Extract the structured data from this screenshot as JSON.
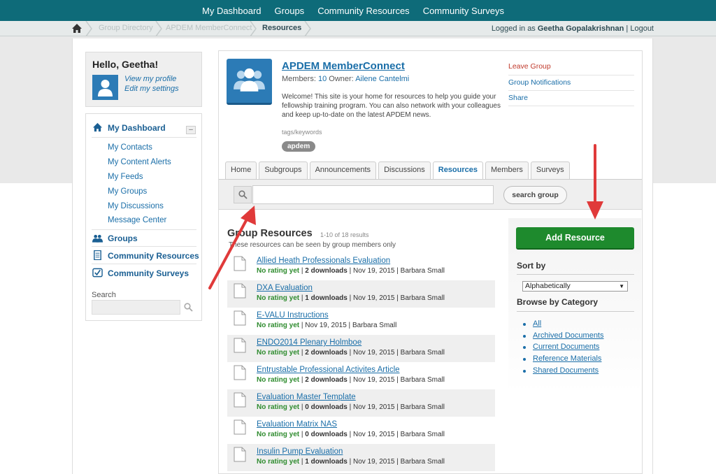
{
  "topnav": [
    "My Dashboard",
    "Groups",
    "Community Resources",
    "Community Surveys"
  ],
  "breadcrumb": {
    "items": [
      "Group Directory",
      "APDEM MemberConnect"
    ],
    "current": "Resources"
  },
  "login": {
    "prefix": "Logged in as",
    "user": "Geetha Gopalakrishnan",
    "sep": "|",
    "logout": "Logout"
  },
  "profile": {
    "greeting": "Hello, Geetha!",
    "view_profile": "View my profile",
    "edit_settings": "Edit my settings"
  },
  "sidebar": {
    "dashboard": "My Dashboard",
    "collapse": "–",
    "items": [
      "My Contacts",
      "My Content Alerts",
      "My Feeds",
      "My Groups",
      "My Discussions",
      "Message Center"
    ],
    "groups": "Groups",
    "community_resources": "Community Resources",
    "community_surveys": "Community Surveys",
    "search_label": "Search"
  },
  "group": {
    "title": "APDEM MemberConnect",
    "members_label": "Members:",
    "members_count": "10",
    "owner_label": "Owner:",
    "owner": "Ailene Cantelmi",
    "welcome": "Welcome! This site is your home for resources to help you guide your fellowship training program. You can also network with your colleagues and keep up-to-date on the latest APDEM news.",
    "tags_label": "tags/keywords",
    "tag": "apdem",
    "links": {
      "leave": "Leave Group",
      "notifications": "Group Notifications",
      "share": "Share"
    }
  },
  "tabs": [
    "Home",
    "Subgroups",
    "Announcements",
    "Discussions",
    "Resources",
    "Members",
    "Surveys"
  ],
  "active_tab": "Resources",
  "search": {
    "button": "search group",
    "value": ""
  },
  "resources": {
    "title": "Group Resources",
    "count": "1-10 of 18 results",
    "subtitle": "These resources can be seen by group members only",
    "rows": [
      {
        "title": "Allied Heath Professionals Evaluation",
        "rating": "No rating yet",
        "downloads": "2 downloads",
        "date": "Nov 19, 2015",
        "author": "Barbara Small"
      },
      {
        "title": "DXA Evaluation",
        "rating": "No rating yet",
        "downloads": "1 downloads",
        "date": "Nov 19, 2015",
        "author": "Barbara Small"
      },
      {
        "title": "E-VALU Instructions",
        "rating": "No rating yet",
        "downloads": "",
        "date": "Nov 19, 2015",
        "author": "Barbara Small"
      },
      {
        "title": "ENDO2014 Plenary Holmboe",
        "rating": "No rating yet",
        "downloads": "2 downloads",
        "date": "Nov 19, 2015",
        "author": "Barbara Small"
      },
      {
        "title": "Entrustable Professional Activites Article",
        "rating": "No rating yet",
        "downloads": "2 downloads",
        "date": "Nov 19, 2015",
        "author": "Barbara Small"
      },
      {
        "title": "Evaluation Master Template",
        "rating": "No rating yet",
        "downloads": "0 downloads",
        "date": "Nov 19, 2015",
        "author": "Barbara Small"
      },
      {
        "title": "Evaluation Matrix NAS",
        "rating": "No rating yet",
        "downloads": "0 downloads",
        "date": "Nov 19, 2015",
        "author": "Barbara Small"
      },
      {
        "title": "Insulin Pump Evaluation",
        "rating": "No rating yet",
        "downloads": "1 downloads",
        "date": "Nov 19, 2015",
        "author": "Barbara Small"
      }
    ]
  },
  "right": {
    "add_button": "Add Resource",
    "sort_label": "Sort by",
    "sort_value": "Alphabetically",
    "browse_label": "Browse by Category",
    "categories": [
      "All",
      "Archived Documents",
      "Current Documents",
      "Reference Materials",
      "Shared Documents"
    ]
  },
  "colors": {
    "nav": "#0e6b79",
    "link": "#1a6ea8",
    "add_button": "#1e8a2d",
    "arrow": "#e03a3a",
    "rating": "#2e8b2e"
  }
}
